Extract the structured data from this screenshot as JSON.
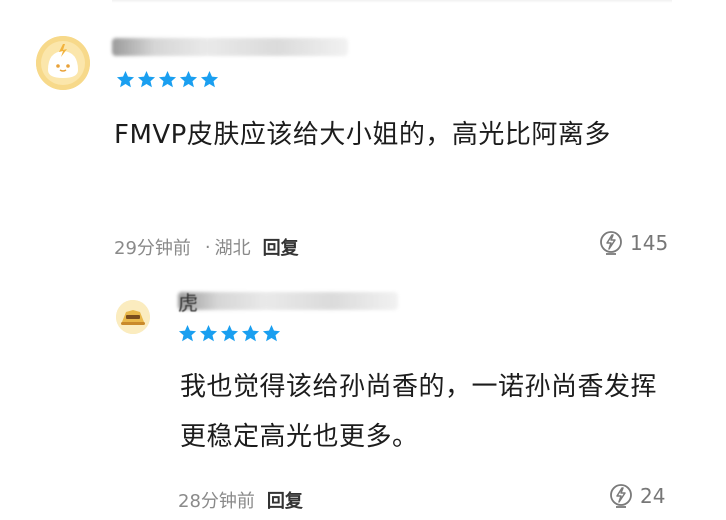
{
  "comment": {
    "username_visible_char": "",
    "text": "FMVP皮肤应该给大小姐的，高光比阿离多",
    "rating_stars": 5,
    "time": "29分钟前",
    "location_sep": "·",
    "location": "湖北",
    "reply_label": "回复",
    "likes": "145"
  },
  "reply": {
    "username_visible_char": "虎",
    "text": "我也觉得该给孙尚香的，一诺孙尚香发挥更稳定高光也更多。",
    "rating_stars": 5,
    "time": "28分钟前",
    "reply_label": "回复",
    "likes": "24"
  },
  "colors": {
    "star": "#1a9ff0",
    "meta": "#8a8a8a",
    "reply_label": "#333333"
  },
  "icons": {
    "like": "lightning-thumb-icon",
    "star": "star-icon"
  }
}
